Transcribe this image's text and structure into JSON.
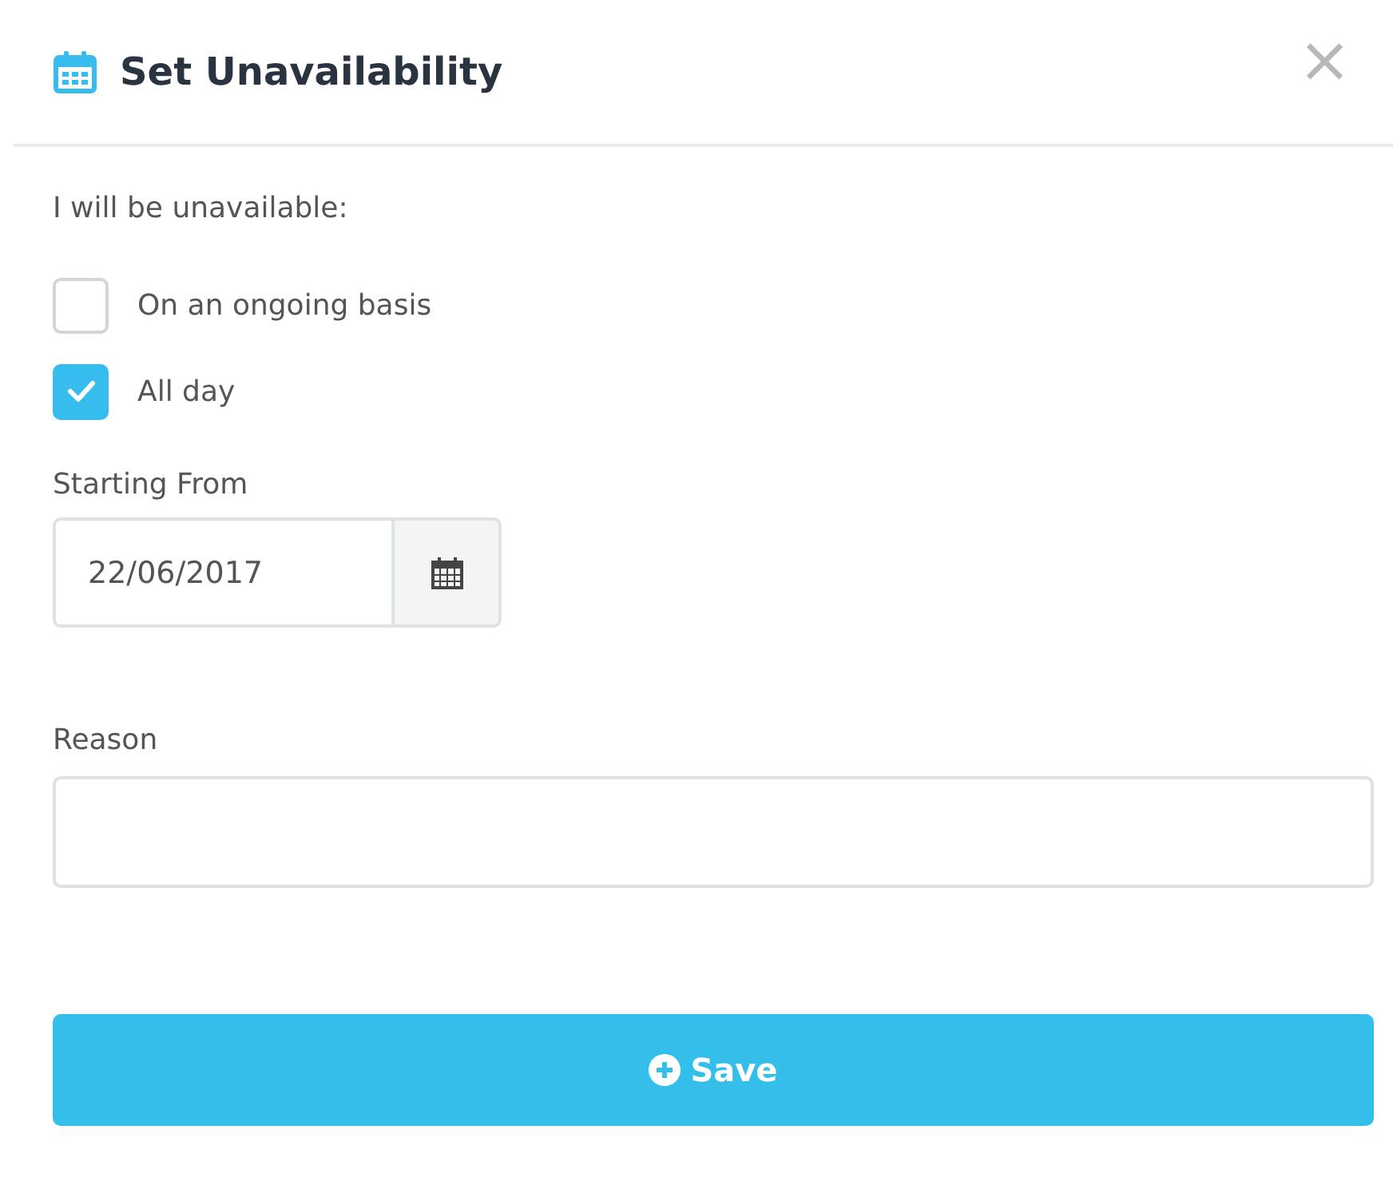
{
  "dialog": {
    "title": "Set Unavailability",
    "close": "×"
  },
  "intro": "I will be unavailable:",
  "options": [
    {
      "label": "On an ongoing basis",
      "checked": false
    },
    {
      "label": "All day",
      "checked": true
    }
  ],
  "start": {
    "label": "Starting From",
    "value": "22/06/2017"
  },
  "reason": {
    "label": "Reason"
  },
  "save": "Save"
}
